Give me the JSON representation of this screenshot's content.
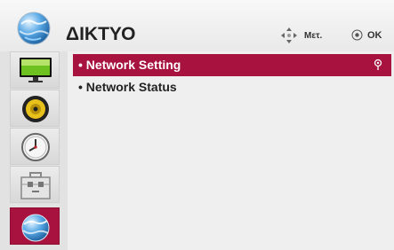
{
  "header": {
    "title": "ΔΙΚΤΥΟ",
    "icon": "network-globe-icon",
    "hint_move_icon": "four-way-arrow-icon",
    "hint_move_label": "Μετ.",
    "hint_ok_icon": "ok-button-icon",
    "hint_ok_label": "OK"
  },
  "sidebar": {
    "items": [
      {
        "icon": "picture-tv-icon",
        "selected": false
      },
      {
        "icon": "audio-speaker-icon",
        "selected": false
      },
      {
        "icon": "time-clock-icon",
        "selected": false
      },
      {
        "icon": "settings-toolbox-icon",
        "selected": false
      },
      {
        "icon": "network-globe-icon",
        "selected": true
      }
    ]
  },
  "menu": {
    "items": [
      {
        "label": "• Network Setting",
        "selected": true
      },
      {
        "label": "• Network Status",
        "selected": false
      }
    ]
  },
  "colors": {
    "accent": "#a7123f",
    "background": "#efefef",
    "text": "#222222"
  }
}
